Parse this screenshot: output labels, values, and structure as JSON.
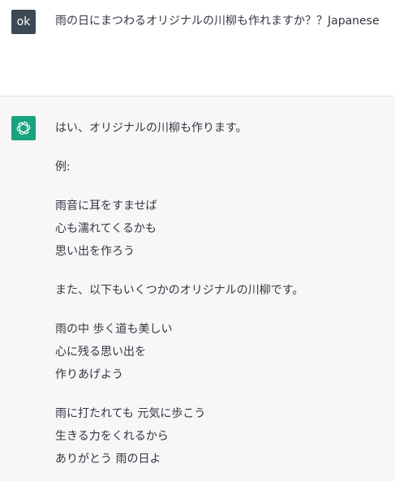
{
  "user": {
    "avatar_text": "ok",
    "message": "雨の日にまつわるオリジナルの川柳も作れますか？？Japanese"
  },
  "assistant": {
    "avatar_icon": "openai-logo-icon",
    "paragraphs": [
      [
        "はい、オリジナルの川柳も作ります。"
      ],
      [
        "例:"
      ],
      [
        "雨音に耳をすませば",
        "心も濡れてくるかも",
        "思い出を作ろう"
      ],
      [
        "また、以下もいくつかのオリジナルの川柳です。"
      ],
      [
        "雨の中 歩く道も美しい",
        "心に残る思い出を",
        "作りあげよう"
      ],
      [
        "雨に打たれても 元気に歩こう",
        "生きる力をくれるから",
        "ありがとう 雨の日よ"
      ]
    ]
  },
  "colors": {
    "user_avatar_bg": "#3d4a55",
    "bot_avatar_bg": "#19a37f",
    "assistant_bg": "#f7f7f8",
    "text": "#343541"
  }
}
